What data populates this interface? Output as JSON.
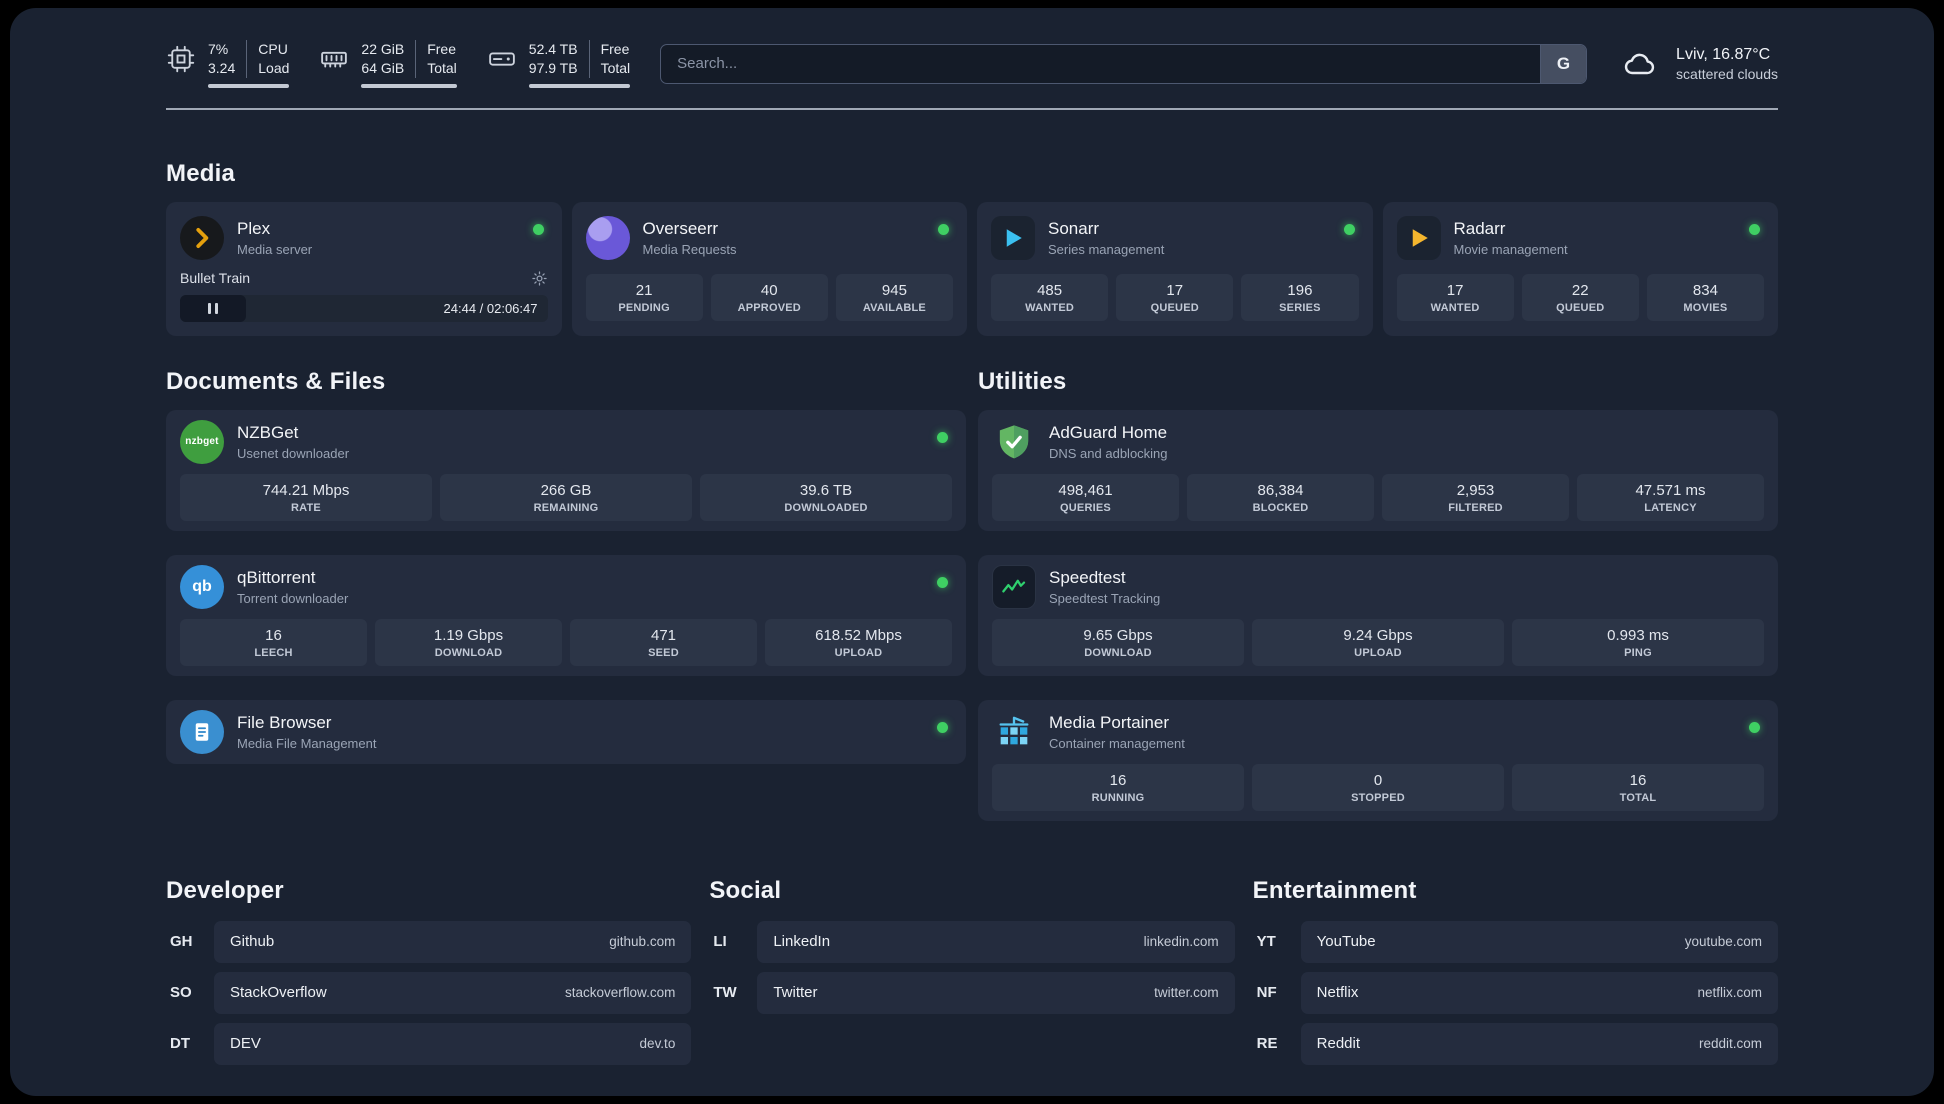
{
  "topbar": {
    "cpu": {
      "value_top": "7%",
      "value_bottom": "3.24",
      "label_top": "CPU",
      "label_bottom": "Load"
    },
    "ram": {
      "value_top": "22 GiB",
      "value_bottom": "64 GiB",
      "label_top": "Free",
      "label_bottom": "Total"
    },
    "disk": {
      "value_top": "52.4 TB",
      "value_bottom": "97.9 TB",
      "label_top": "Free",
      "label_bottom": "Total"
    },
    "search": {
      "placeholder": "Search...",
      "engine_label": "G"
    },
    "weather": {
      "location": "Lviv, 16.87°C",
      "condition": "scattered clouds"
    }
  },
  "sections": {
    "media": "Media",
    "documents": "Documents & Files",
    "utilities": "Utilities"
  },
  "apps": {
    "plex": {
      "name": "Plex",
      "subtitle": "Media server",
      "now_playing": "Bullet Train",
      "time": "24:44 / 02:06:47"
    },
    "overseerr": {
      "name": "Overseerr",
      "subtitle": "Media Requests",
      "stats": [
        {
          "value": "21",
          "label": "PENDING"
        },
        {
          "value": "40",
          "label": "APPROVED"
        },
        {
          "value": "945",
          "label": "AVAILABLE"
        }
      ]
    },
    "sonarr": {
      "name": "Sonarr",
      "subtitle": "Series management",
      "stats": [
        {
          "value": "485",
          "label": "WANTED"
        },
        {
          "value": "17",
          "label": "QUEUED"
        },
        {
          "value": "196",
          "label": "SERIES"
        }
      ]
    },
    "radarr": {
      "name": "Radarr",
      "subtitle": "Movie management",
      "stats": [
        {
          "value": "17",
          "label": "WANTED"
        },
        {
          "value": "22",
          "label": "QUEUED"
        },
        {
          "value": "834",
          "label": "MOVIES"
        }
      ]
    },
    "nzbget": {
      "name": "NZBGet",
      "subtitle": "Usenet downloader",
      "icon_text": "nzbget",
      "stats": [
        {
          "value": "744.21 Mbps",
          "label": "RATE"
        },
        {
          "value": "266 GB",
          "label": "REMAINING"
        },
        {
          "value": "39.6 TB",
          "label": "DOWNLOADED"
        }
      ]
    },
    "qbittorrent": {
      "name": "qBittorrent",
      "subtitle": "Torrent downloader",
      "icon_text": "qb",
      "stats": [
        {
          "value": "16",
          "label": "LEECH"
        },
        {
          "value": "1.19 Gbps",
          "label": "DOWNLOAD"
        },
        {
          "value": "471",
          "label": "SEED"
        },
        {
          "value": "618.52 Mbps",
          "label": "UPLOAD"
        }
      ]
    },
    "filebrowser": {
      "name": "File Browser",
      "subtitle": "Media File Management"
    },
    "adguard": {
      "name": "AdGuard Home",
      "subtitle": "DNS and adblocking",
      "stats": [
        {
          "value": "498,461",
          "label": "QUERIES"
        },
        {
          "value": "86,384",
          "label": "BLOCKED"
        },
        {
          "value": "2,953",
          "label": "FILTERED"
        },
        {
          "value": "47.571 ms",
          "label": "LATENCY"
        }
      ]
    },
    "speedtest": {
      "name": "Speedtest",
      "subtitle": "Speedtest Tracking",
      "stats": [
        {
          "value": "9.65 Gbps",
          "label": "DOWNLOAD"
        },
        {
          "value": "9.24 Gbps",
          "label": "UPLOAD"
        },
        {
          "value": "0.993 ms",
          "label": "PING"
        }
      ]
    },
    "portainer": {
      "name": "Media Portainer",
      "subtitle": "Container management",
      "stats": [
        {
          "value": "16",
          "label": "RUNNING"
        },
        {
          "value": "0",
          "label": "STOPPED"
        },
        {
          "value": "16",
          "label": "TOTAL"
        }
      ]
    }
  },
  "bookmarks": {
    "developer": {
      "title": "Developer",
      "items": [
        {
          "abbr": "GH",
          "name": "Github",
          "url": "github.com"
        },
        {
          "abbr": "SO",
          "name": "StackOverflow",
          "url": "stackoverflow.com"
        },
        {
          "abbr": "DT",
          "name": "DEV",
          "url": "dev.to"
        }
      ]
    },
    "social": {
      "title": "Social",
      "items": [
        {
          "abbr": "LI",
          "name": "LinkedIn",
          "url": "linkedin.com"
        },
        {
          "abbr": "TW",
          "name": "Twitter",
          "url": "twitter.com"
        }
      ]
    },
    "entertainment": {
      "title": "Entertainment",
      "items": [
        {
          "abbr": "YT",
          "name": "YouTube",
          "url": "youtube.com"
        },
        {
          "abbr": "NF",
          "name": "Netflix",
          "url": "netflix.com"
        },
        {
          "abbr": "RE",
          "name": "Reddit",
          "url": "reddit.com"
        }
      ]
    }
  },
  "icons": {
    "cpu": "cpu-chip",
    "ram": "memory-stick",
    "disk": "hard-drive",
    "weather": "cloud",
    "plex": "orange-chevron",
    "settings": "gear",
    "player": "pause",
    "adguard": "green-shield-check",
    "speedtest": "green-waveform",
    "portainer": "crane-containers"
  },
  "colors": {
    "background": "#1a2231",
    "card": "#242c3e",
    "stat_box": "#2c3547",
    "status_online": "#3fcf63",
    "text_primary": "#f2f4f8",
    "text_secondary": "#9aa4b5",
    "plex_accent": "#e5a00d",
    "sonarr_accent": "#3bc0f0",
    "radarr_accent": "#f5b62e",
    "nzbget_accent": "#3f9e3f",
    "qbittorrent_accent": "#3590d8",
    "adguard_accent": "#63b663",
    "speedtest_accent": "#2fd06e",
    "portainer_accent": "#2fa8df",
    "overseerr_accent": "#6a58d8"
  }
}
